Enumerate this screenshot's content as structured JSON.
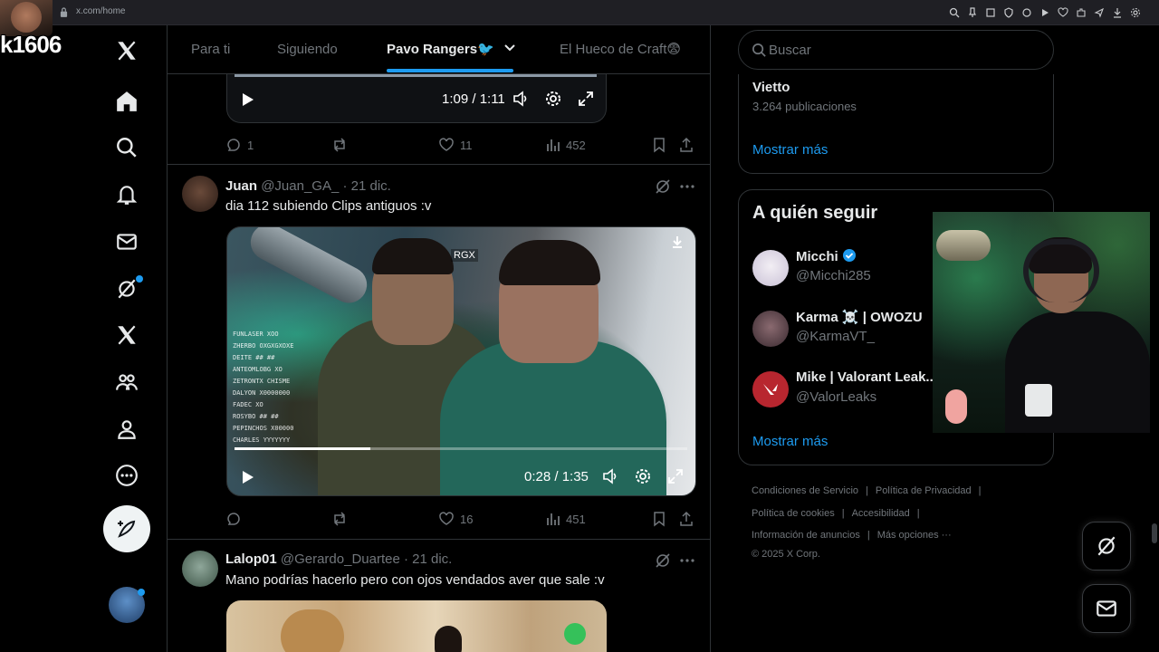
{
  "browser": {
    "url": "x.com/home"
  },
  "stream": {
    "name": "k1606"
  },
  "tabs": [
    {
      "label": "Para ti"
    },
    {
      "label": "Siguiendo"
    },
    {
      "label": "Pavo Rangers🐦"
    },
    {
      "label": "El Hueco de Craft😨"
    }
  ],
  "prev_video": {
    "time": "1:09 / 1:11",
    "replies": "1",
    "likes": "11",
    "views": "452"
  },
  "tweets": [
    {
      "name": "Juan",
      "handle": "@Juan_GA_ · 21 dic.",
      "text": "dia 112 subiendo Clips antiguos :v",
      "video_time": "0:28 / 1:35",
      "video_progress": 0.3,
      "video_tag": "RGX",
      "video_list": [
        "FUNLASER  XOO",
        "ZHERBO  OXGXGXOXE",
        "DEITE  ## ##",
        "ANTEOMLOBG  XO",
        "ZETRONTX  CHISME",
        "DALYON  X0000000",
        "FADEC  XO",
        "ROSYBO  ## ##",
        "PEPINCHOS  X00000",
        "CHARLES  YYYYYYY"
      ],
      "replies": "",
      "likes": "16",
      "views": "451"
    },
    {
      "name": "Lalop01",
      "handle": "@Gerardo_Duartee · 21 dic.",
      "text": "Mano podrías hacerlo pero con ojos vendados aver que sale :v"
    }
  ],
  "search": {
    "placeholder": "Buscar"
  },
  "trend_card": {
    "title": "Vietto",
    "subtitle": "3.264 publicaciones",
    "show_more": "Mostrar más"
  },
  "who_to_follow": {
    "title": "A quién seguir",
    "show_more": "Mostrar más",
    "accounts": [
      {
        "name": "Micchi",
        "handle": "@Micchi285",
        "verified": true
      },
      {
        "name": "Karma ☠️ | OWOZU",
        "handle": "@KarmaVT_"
      },
      {
        "name": "Mike | Valorant Leak...",
        "handle": "@ValorLeaks"
      }
    ]
  },
  "footer": {
    "links": [
      "Condiciones de Servicio",
      "Política de Privacidad",
      "Política de cookies",
      "Accesibilidad",
      "Información de anuncios",
      "Más opciones ···"
    ],
    "copyright": "© 2025 X Corp."
  },
  "colors": {
    "accent": "#1d9bf0",
    "bg": "#000000",
    "border": "#2f3336",
    "muted": "#71767b"
  }
}
